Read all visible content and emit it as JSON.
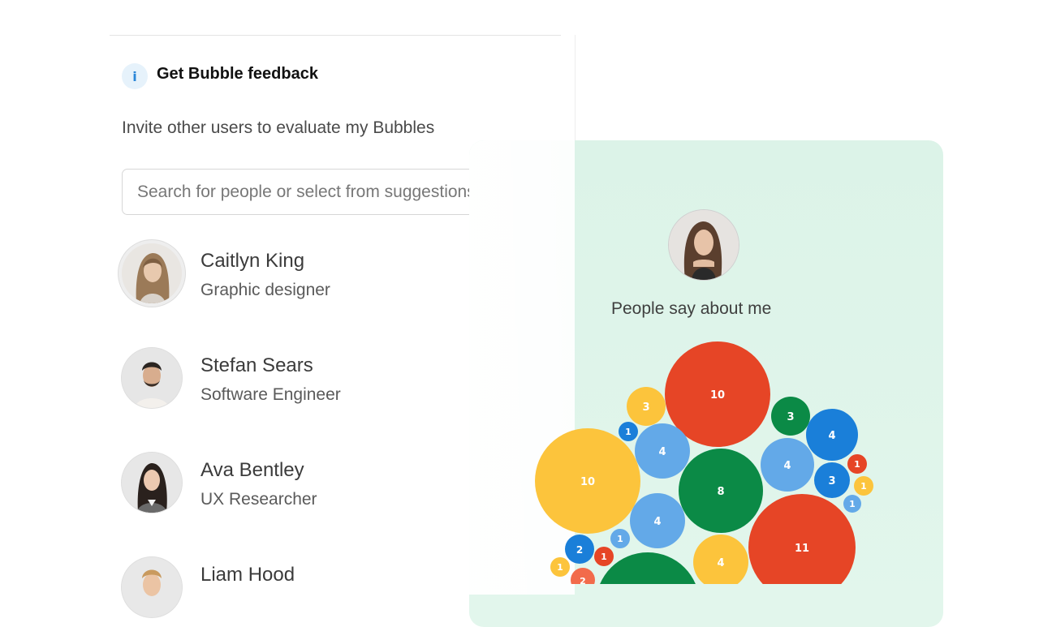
{
  "feedback_panel": {
    "title": "Get Bubble feedback",
    "subtitle": "Invite other users to evaluate my Bubbles",
    "info_icon_glyph": "i",
    "search_placeholder": "Search for people or select from suggestions",
    "people": [
      {
        "name": "Caitlyn King",
        "role": "Graphic designer",
        "avatar": "woman-wavy-hair-avatar",
        "selected": true
      },
      {
        "name": "Stefan Sears",
        "role": "Software Engineer",
        "avatar": "man-beard-avatar",
        "selected": false
      },
      {
        "name": "Ava Bentley",
        "role": "UX Researcher",
        "avatar": "woman-dark-hair-avatar",
        "selected": false
      },
      {
        "name": "Liam Hood",
        "role": "",
        "avatar": "man-blond-avatar",
        "selected": false
      }
    ]
  },
  "profile_card": {
    "heading": "People say about me",
    "avatar": "woman-portrait-avatar",
    "colors": {
      "red": "#e64526",
      "yellow": "#fcc43c",
      "green": "#0b8a46",
      "blue": "#1a7fd9",
      "light_blue": "#63a9e8",
      "orange": "#f26b4b"
    },
    "bubbles": [
      {
        "value": 10,
        "color": "red"
      },
      {
        "value": 3,
        "color": "yellow"
      },
      {
        "value": 1,
        "color": "blue"
      },
      {
        "value": 4,
        "color": "light_blue"
      },
      {
        "value": 3,
        "color": "green"
      },
      {
        "value": 4,
        "color": "blue"
      },
      {
        "value": 10,
        "color": "yellow"
      },
      {
        "value": 8,
        "color": "green"
      },
      {
        "value": 4,
        "color": "light_blue"
      },
      {
        "value": 1,
        "color": "red"
      },
      {
        "value": 3,
        "color": "blue"
      },
      {
        "value": 1,
        "color": "yellow"
      },
      {
        "value": 1,
        "color": "light_blue"
      },
      {
        "value": 4,
        "color": "light_blue"
      },
      {
        "value": 11,
        "color": "red"
      },
      {
        "value": 4,
        "color": "yellow"
      },
      {
        "value": 1,
        "color": "light_blue"
      },
      {
        "value": 2,
        "color": "blue"
      },
      {
        "value": 1,
        "color": "red"
      },
      {
        "value": 1,
        "color": "yellow"
      },
      {
        "value": 2,
        "color": "orange"
      },
      {
        "value": null,
        "color": "green"
      }
    ]
  }
}
